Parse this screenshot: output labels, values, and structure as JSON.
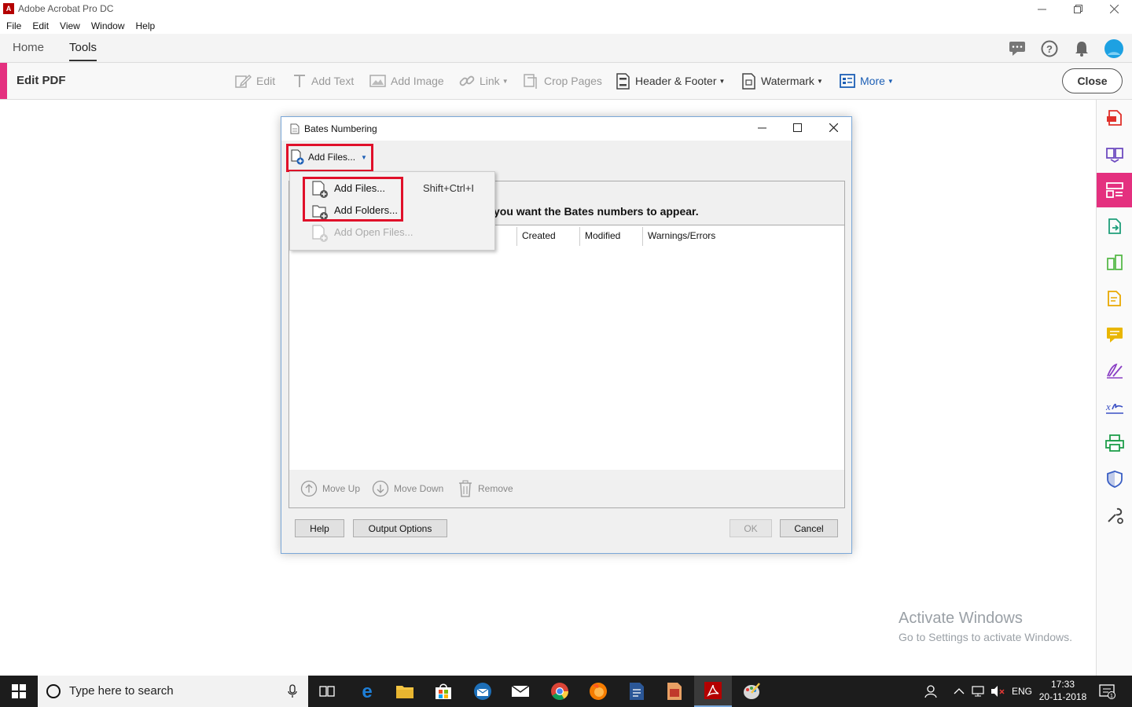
{
  "window": {
    "title": "Adobe Acrobat Pro DC",
    "logo_text": "A"
  },
  "menubar": {
    "items": [
      "File",
      "Edit",
      "View",
      "Window",
      "Help"
    ]
  },
  "topnav": {
    "tabs": [
      "Home",
      "Tools"
    ],
    "active_tab": "Tools"
  },
  "toolbar": {
    "title": "Edit PDF",
    "tools": [
      {
        "label": "Edit",
        "icon": "edit-icon",
        "enabled": false
      },
      {
        "label": "Add Text",
        "icon": "text-icon",
        "enabled": false
      },
      {
        "label": "Add Image",
        "icon": "image-icon",
        "enabled": false
      },
      {
        "label": "Link",
        "icon": "link-icon",
        "enabled": false,
        "dropdown": true
      },
      {
        "label": "Crop Pages",
        "icon": "crop-icon",
        "enabled": false
      },
      {
        "label": "Header & Footer",
        "icon": "header-footer-icon",
        "enabled": true,
        "dropdown": true
      },
      {
        "label": "Watermark",
        "icon": "watermark-icon",
        "enabled": true,
        "dropdown": true
      },
      {
        "label": "More",
        "icon": "more-icon",
        "enabled": true,
        "dropdown": true
      }
    ],
    "close_label": "Close"
  },
  "dialog": {
    "title": "Bates Numbering",
    "add_files_label": "Add Files...",
    "instruction": "you want the Bates numbers to appear.",
    "columns": [
      "Created",
      "Modified",
      "Warnings/Errors"
    ],
    "bottom_actions": [
      "Move Up",
      "Move Down",
      "Remove"
    ],
    "buttons": {
      "help": "Help",
      "output_options": "Output Options",
      "ok": "OK",
      "cancel": "Cancel"
    }
  },
  "dropdown_menu": {
    "items": [
      {
        "label": "Add Files...",
        "shortcut": "Shift+Ctrl+I",
        "enabled": true
      },
      {
        "label": "Add Folders...",
        "shortcut": "",
        "enabled": true
      },
      {
        "label": "Add Open Files...",
        "shortcut": "",
        "enabled": false
      }
    ]
  },
  "activation": {
    "title": "Activate Windows",
    "subtitle": "Go to Settings to activate Windows."
  },
  "taskbar": {
    "search_placeholder": "Type here to search",
    "language": "ENG",
    "time": "17:33",
    "date": "20-11-2018",
    "notification_count": "1"
  },
  "colors": {
    "accent_pink": "#e4307f",
    "highlight_red": "#e0102a",
    "link_blue": "#1c5fb5"
  }
}
